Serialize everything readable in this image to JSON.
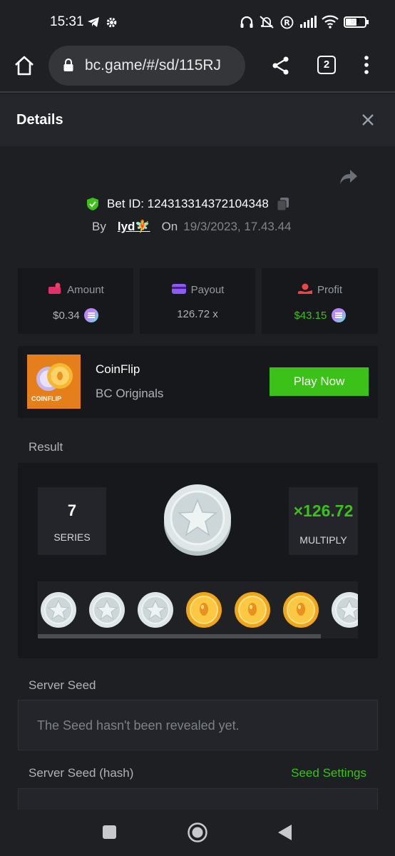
{
  "status_bar": {
    "time": "15:31",
    "battery": "59"
  },
  "browser": {
    "url": "bc.game/#/sd/115RJ",
    "tab_count": "2"
  },
  "modal": {
    "title": "Details"
  },
  "bet": {
    "id_text": "Bet ID: 124313314372104348",
    "by_label": "By",
    "user": "lyd🧚",
    "on_label": "On",
    "date": "19/3/2023, 17.43.44"
  },
  "stats": {
    "amount": {
      "label": "Amount",
      "value": "$0.34"
    },
    "payout": {
      "label": "Payout",
      "value": "126.72 x"
    },
    "profit": {
      "label": "Profit",
      "value": "$43.15"
    }
  },
  "game": {
    "thumb_text": "COINFLIP",
    "name": "CoinFlip",
    "provider": "BC Originals",
    "play_label": "Play Now"
  },
  "result": {
    "section_label": "Result",
    "series_value": "7",
    "series_label": "SERIES",
    "multiply_value": "×126.72",
    "multiply_label": "MULTIPLY",
    "coins": [
      "star",
      "star",
      "star",
      "gold",
      "gold",
      "gold",
      "star"
    ]
  },
  "server_seed": {
    "label": "Server Seed",
    "text": "The Seed hasn't been revealed yet."
  },
  "server_seed_hash": {
    "label": "Server Seed (hash)",
    "settings_link": "Seed Settings"
  },
  "colors": {
    "accent_green": "#3bc117",
    "panel": "#17181b",
    "background": "#1d1f22"
  }
}
